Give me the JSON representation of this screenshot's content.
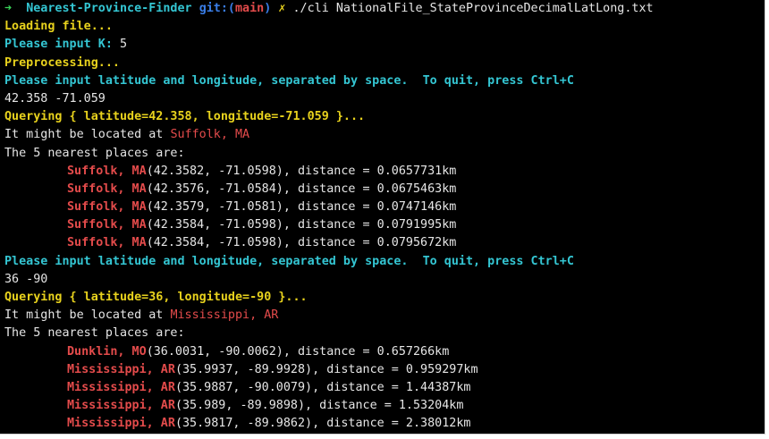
{
  "theme": {
    "background": "#000000",
    "cyan": "#34c6d3",
    "yellow": "#e8d21d",
    "red": "#e34b4b",
    "green": "#3ad55a",
    "text": "#e6e6e6"
  },
  "prompt": {
    "arrow": "➜",
    "directory": "Nearest-Province-Finder",
    "git_label": "git:(",
    "branch": "main",
    "git_close": ")",
    "dirty_mark": "✗",
    "command": "./cli NationalFile_StateProvinceDecimalLatLong.txt"
  },
  "output": {
    "loading": "Loading file...",
    "k_prompt": "Please input K: ",
    "k_value": "5",
    "preprocessing": "Preprocessing...",
    "instruction": "Please input latitude and longitude, separated by space.  To quit, press Ctrl+C"
  },
  "queries": [
    {
      "input": "42.358 -71.059",
      "querying": "Querying { latitude=42.358, longitude=-71.059 }...",
      "located_prefix": "It might be located at ",
      "located_place": "Suffolk, MA",
      "nearest_header": "The 5 nearest places are:",
      "results": [
        {
          "place": "Suffolk, MA",
          "detail": "(42.3582, -71.0598), distance = 0.0657731km"
        },
        {
          "place": "Suffolk, MA",
          "detail": "(42.3576, -71.0584), distance = 0.0675463km"
        },
        {
          "place": "Suffolk, MA",
          "detail": "(42.3579, -71.0581), distance = 0.0747146km"
        },
        {
          "place": "Suffolk, MA",
          "detail": "(42.3584, -71.0598), distance = 0.0791995km"
        },
        {
          "place": "Suffolk, MA",
          "detail": "(42.3584, -71.0598), distance = 0.0795672km"
        }
      ],
      "next_instruction": "Please input latitude and longitude, separated by space.  To quit, press Ctrl+C"
    },
    {
      "input": "36 -90",
      "querying": "Querying { latitude=36, longitude=-90 }...",
      "located_prefix": "It might be located at ",
      "located_place": "Mississippi, AR",
      "nearest_header": "The 5 nearest places are:",
      "results": [
        {
          "place": "Dunklin, MO",
          "detail": "(36.0031, -90.0062), distance = 0.657266km"
        },
        {
          "place": "Mississippi, AR",
          "detail": "(35.9937, -89.9928), distance = 0.959297km"
        },
        {
          "place": "Mississippi, AR",
          "detail": "(35.9887, -90.0079), distance = 1.44387km"
        },
        {
          "place": "Mississippi, AR",
          "detail": "(35.989, -89.9898), distance = 1.53204km"
        },
        {
          "place": "Mississippi, AR",
          "detail": "(35.9817, -89.9862), distance = 2.38012km"
        }
      ]
    }
  ]
}
